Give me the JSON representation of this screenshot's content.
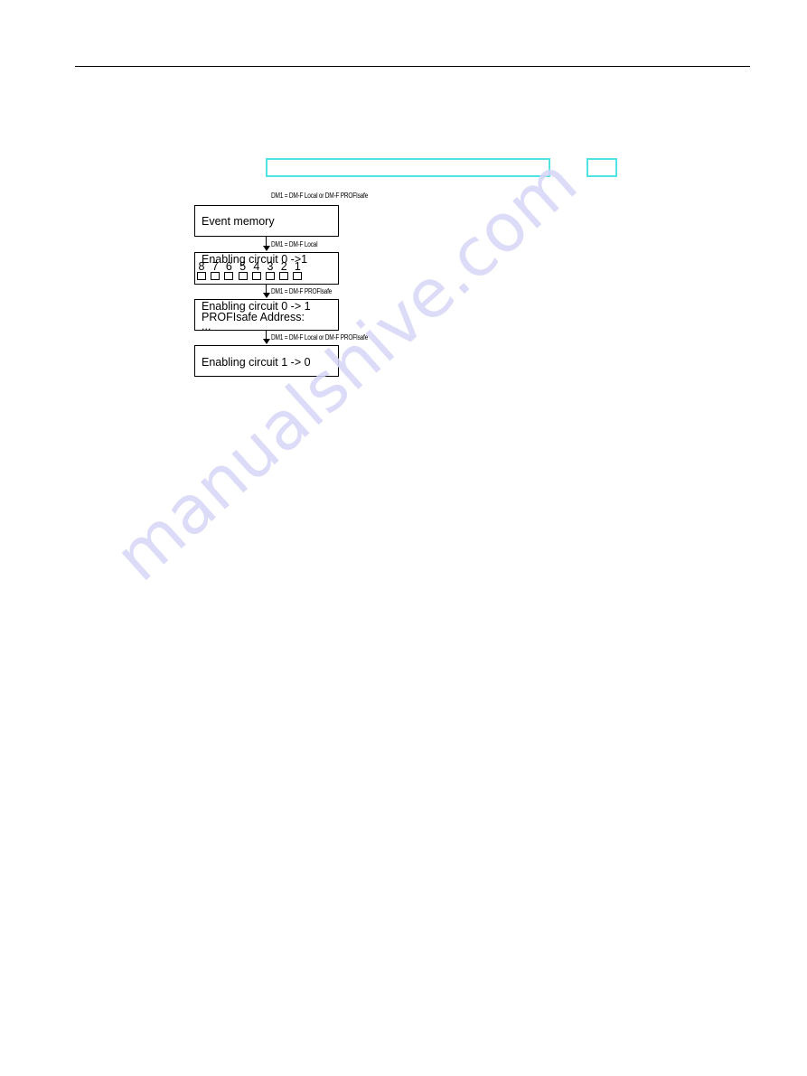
{
  "page": {
    "header_rule": true,
    "highlight_boxes": [
      {
        "name": "highlight-box-wide",
        "color": "#4fe3e3"
      },
      {
        "name": "highlight-box-small",
        "color": "#4fe3e3"
      }
    ],
    "watermark": "manualshive.com"
  },
  "diagram": {
    "top_condition": "DM1 = DM-F Local or DM-F PROFIsafe",
    "boxes": [
      {
        "lines": [
          "Event memory"
        ]
      },
      {
        "lines": [
          "Enabling circuit 0 ->1"
        ],
        "bits": [
          "8",
          "7",
          "6",
          "5",
          "4",
          "3",
          "2",
          "1"
        ]
      },
      {
        "lines": [
          "Enabling circuit 0 -> 1",
          "PROFIsafe Address:",
          "..."
        ]
      },
      {
        "lines": [
          "Enabling circuit 1 -> 0"
        ]
      }
    ],
    "transitions": [
      {
        "condition": "DM1 = DM-F Local"
      },
      {
        "condition": "DM1 = DM-F PROFIsafe"
      },
      {
        "condition": "DM1 = DM-F Local or DM-F PROFIsafe"
      }
    ]
  }
}
